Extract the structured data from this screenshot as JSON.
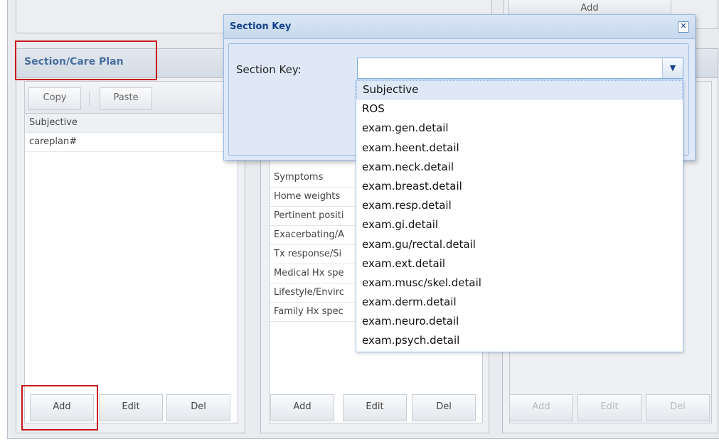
{
  "top": {
    "add_label": "Add"
  },
  "section_panel": {
    "title": "Section/Care Plan",
    "copy_label": "Copy",
    "paste_label": "Paste",
    "header_row": "Subjective",
    "rows": [
      "careplan#"
    ],
    "add_label": "Add",
    "edit_label": "Edit",
    "del_label": "Del"
  },
  "middle_panel": {
    "rows": [
      "Symptoms",
      "Home weights",
      "Pertinent positi",
      "Exacerbating/A",
      "Tx response/Si",
      "Medical Hx spe",
      "Lifestyle/Envirc",
      "Family Hx spec"
    ],
    "add_label": "Add",
    "edit_label": "Edit",
    "del_label": "Del"
  },
  "right_panel": {
    "add_label": "Add",
    "edit_label": "Edit",
    "del_label": "Del"
  },
  "dialog": {
    "title": "Section Key",
    "close_icon": "close-icon",
    "label": "Section Key:",
    "value": "",
    "options": [
      "Subjective",
      "ROS",
      "exam.gen.detail",
      "exam.heent.detail",
      "exam.neck.detail",
      "exam.breast.detail",
      "exam.resp.detail",
      "exam.gi.detail",
      "exam.gu/rectal.detail",
      "exam.ext.detail",
      "exam.musc/skel.detail",
      "exam.derm.detail",
      "exam.neuro.detail",
      "exam.psych.detail"
    ],
    "highlighted_option": "Subjective"
  },
  "colors": {
    "highlight": "#c8181e",
    "title_blue": "#15428b",
    "panel_title": "#4a6fa0"
  }
}
